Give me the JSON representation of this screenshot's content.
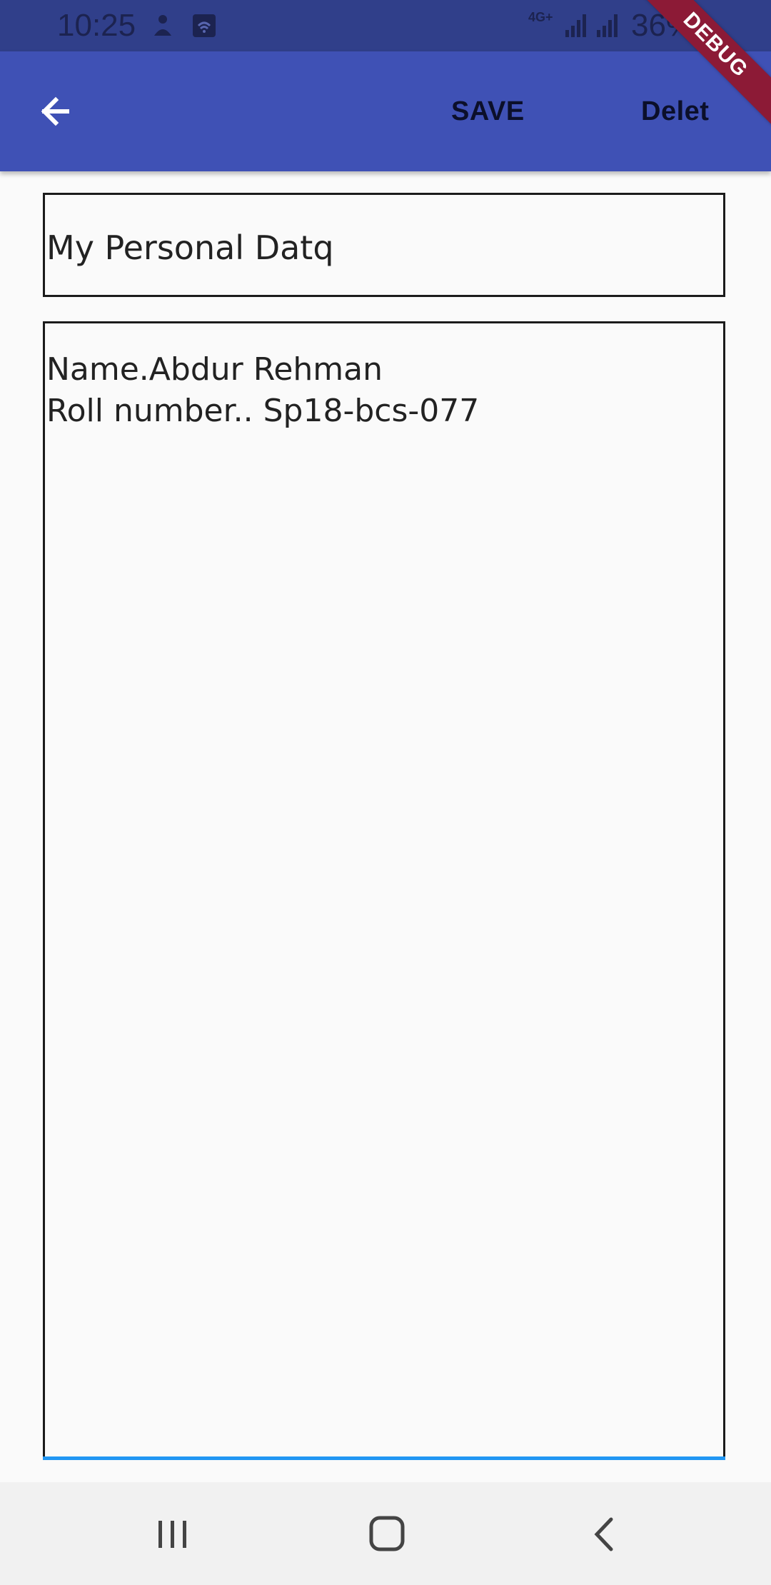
{
  "status_bar": {
    "time": "10:25",
    "network": "4G+",
    "battery": "36%",
    "icons": [
      "person-icon",
      "wifi-calling-icon",
      "signal-icon",
      "signal-icon"
    ]
  },
  "app_bar": {
    "back_icon": "arrow-left-icon",
    "save_label": "SAVE",
    "delete_label": "Delet",
    "color": "#3f51b5"
  },
  "debug_banner": "DEBUG",
  "note": {
    "title": "My Personal Datq",
    "content_lines": [
      "Name.Abdur Rehman",
      "Roll number.. Sp18-bcs-077"
    ]
  },
  "nav_bar": {
    "icons": [
      "recent-apps-icon",
      "home-icon",
      "back-icon"
    ]
  },
  "colors": {
    "status_bar": "#303f8a",
    "focus_underline": "#2196f3",
    "debug": "#8c1a36"
  }
}
